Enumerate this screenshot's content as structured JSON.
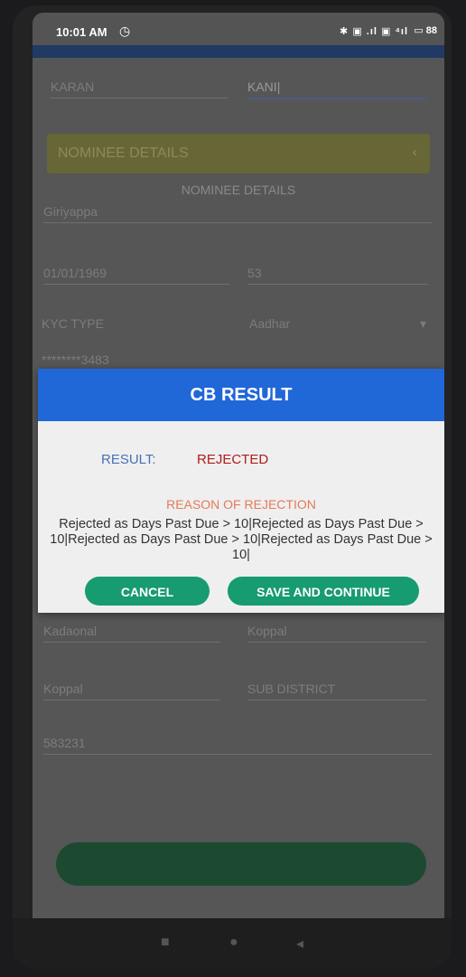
{
  "status": {
    "time": "10:01 AM",
    "icons": "✱ ▣ .ıl ▣ ⁴ıl",
    "battery": "88"
  },
  "form": {
    "first_name": "KARAN",
    "last_name": "KANI",
    "nominee_header": "NOMINEE DETAILS",
    "nominee_subtitle": "NOMINEE DETAILS",
    "nominee_name": "Giriyappa",
    "dob": "01/01/1969",
    "age": "53",
    "kyc_label": "KYC TYPE",
    "kyc_value": "Aadhar",
    "kyc_number": "********3483",
    "village": "Kadaonal",
    "district": "Koppal",
    "taluk": "Koppal",
    "sub_district": "SUB DISTRICT",
    "pincode": "583231"
  },
  "dialog": {
    "title": "CB RESULT",
    "result_label": "RESULT:",
    "result_value": "REJECTED",
    "reason_title": "REASON OF REJECTION",
    "reason_text": "Rejected as Days Past Due > 10|Rejected as Days Past Due > 10|Rejected as Days Past Due > 10|Rejected as Days Past Due > 10|",
    "cancel_label": "CANCEL",
    "save_label": "SAVE AND CONTINUE"
  },
  "colors": {
    "dialog_header": "#2067d8",
    "button": "#179b70",
    "rejected": "#b01c1c"
  }
}
